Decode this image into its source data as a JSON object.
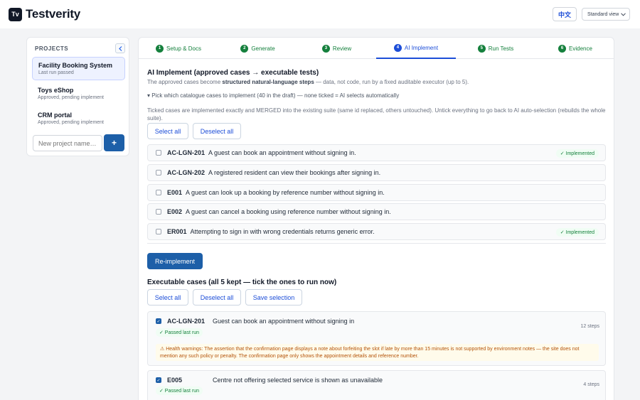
{
  "app": {
    "logo_mark": "Tv",
    "name": "Testverity"
  },
  "header": {
    "language_button": "中文",
    "view_select": "Standard view"
  },
  "sidebar": {
    "heading": "PROJECTS",
    "collapse_icon": "chevron-left-icon",
    "projects": [
      {
        "name": "Facility Booking System",
        "status": "Last run passed",
        "active": true
      },
      {
        "name": "Toys eShop",
        "status": "Approved, pending implement",
        "active": false
      },
      {
        "name": "CRM portal",
        "status": "Approved, pending implement",
        "active": false
      }
    ],
    "new_project_placeholder": "New project name…",
    "add_button": "+"
  },
  "tabs": [
    {
      "num": "1",
      "label": "Setup & Docs"
    },
    {
      "num": "2",
      "label": "Generate"
    },
    {
      "num": "3",
      "label": "Review"
    },
    {
      "num": "4",
      "label": "AI Implement",
      "active": true
    },
    {
      "num": "5",
      "label": "Run Tests"
    },
    {
      "num": "6",
      "label": "Evidence"
    }
  ],
  "implement": {
    "title": "AI Implement (approved cases → executable tests)",
    "subtitle_pre": "The approved cases become ",
    "subtitle_bold": "structured natural-language steps",
    "subtitle_post": " — data, not code, run by a fixed auditable executor (up to 5).",
    "pick_toggle": "▾ Pick which catalogue cases to implement (40 in the draft) — none ticked = AI selects automatically",
    "ticked_note": "Ticked cases are implemented exactly and MERGED into the existing suite (same id replaced, others untouched). Untick everything to go back to AI auto-selection (rebuilds the whole suite).",
    "select_all": "Select all",
    "deselect_all": "Deselect all",
    "cases": [
      {
        "id": "AC-LGN-201",
        "text": "A guest can book an appointment without signing in.",
        "badge": "✓ Implemented"
      },
      {
        "id": "AC-LGN-202",
        "text": "A registered resident can view their bookings after signing in.",
        "badge": ""
      },
      {
        "id": "E001",
        "text": "A guest can look up a booking by reference number without signing in.",
        "badge": ""
      },
      {
        "id": "E002",
        "text": "A guest can cancel a booking using reference number without signing in.",
        "badge": ""
      },
      {
        "id": "ER001",
        "text": "Attempting to sign in with wrong credentials returns generic error.",
        "badge": "✓ Implemented"
      }
    ],
    "reimplement_button": "Re-implement"
  },
  "executable": {
    "title": "Executable cases (all 5 kept — tick the ones to run now)",
    "select_all": "Select all",
    "deselect_all": "Deselect all",
    "save_selection": "Save selection",
    "items": [
      {
        "id": "AC-LGN-201",
        "title": "Guest can book an appointment without signing in",
        "status": "✓ Passed last run",
        "steps": "12 steps",
        "warning": "⚠ Health warnings: The assertion that the confirmation page displays a note about forfeiting the slot if late by more than 15 minutes is not supported by environment notes — the site does not mention any such policy or penalty. The confirmation page only shows the appointment details and reference number."
      },
      {
        "id": "E005",
        "title": "Centre not offering selected service is shown as unavailable",
        "status": "✓ Passed last run",
        "steps": "4 steps"
      }
    ]
  }
}
